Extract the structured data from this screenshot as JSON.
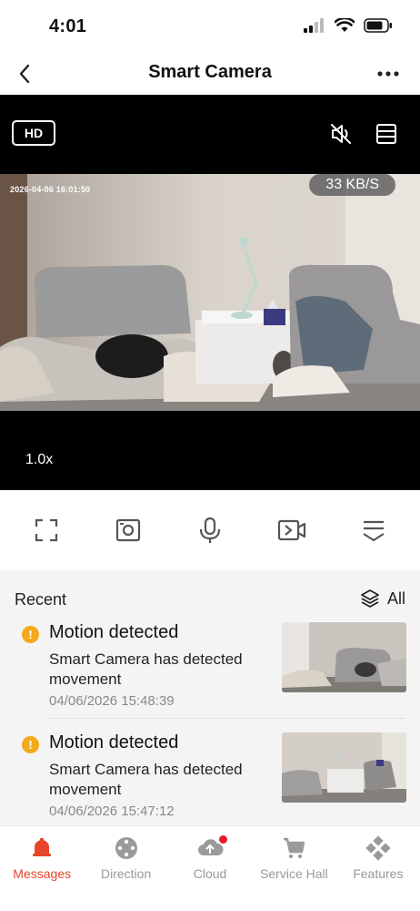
{
  "status_bar": {
    "time": "4:01"
  },
  "nav": {
    "title": "Smart Camera"
  },
  "video": {
    "quality_label": "HD",
    "timestamp": "2026-04-06  16:01:50",
    "speed": "33 KB/S",
    "zoom": "1.0x"
  },
  "controls": [
    "fullscreen-icon",
    "snapshot-icon",
    "microphone-icon",
    "record-video-icon",
    "collapse-icon"
  ],
  "recent": {
    "title": "Recent",
    "filter_label": "All",
    "events": [
      {
        "title": "Motion detected",
        "description": "Smart Camera has detected movement",
        "time": "04/06/2026 15:48:39"
      },
      {
        "title": "Motion detected",
        "description": "Smart Camera has detected movement",
        "time": "04/06/2026 15:47:12"
      }
    ]
  },
  "tabs": [
    {
      "label": "Messages",
      "icon": "bell-icon",
      "active": true
    },
    {
      "label": "Direction",
      "icon": "direction-pad-icon",
      "active": false
    },
    {
      "label": "Cloud",
      "icon": "cloud-upload-icon",
      "active": false,
      "badge": true
    },
    {
      "label": "Service Hall",
      "icon": "cart-icon",
      "active": false
    },
    {
      "label": "Features",
      "icon": "features-icon",
      "active": false
    }
  ],
  "colors": {
    "accent": "#e8442a",
    "warning": "#f2a91a",
    "badge": "#e8192c",
    "video_bg": "#000000"
  }
}
